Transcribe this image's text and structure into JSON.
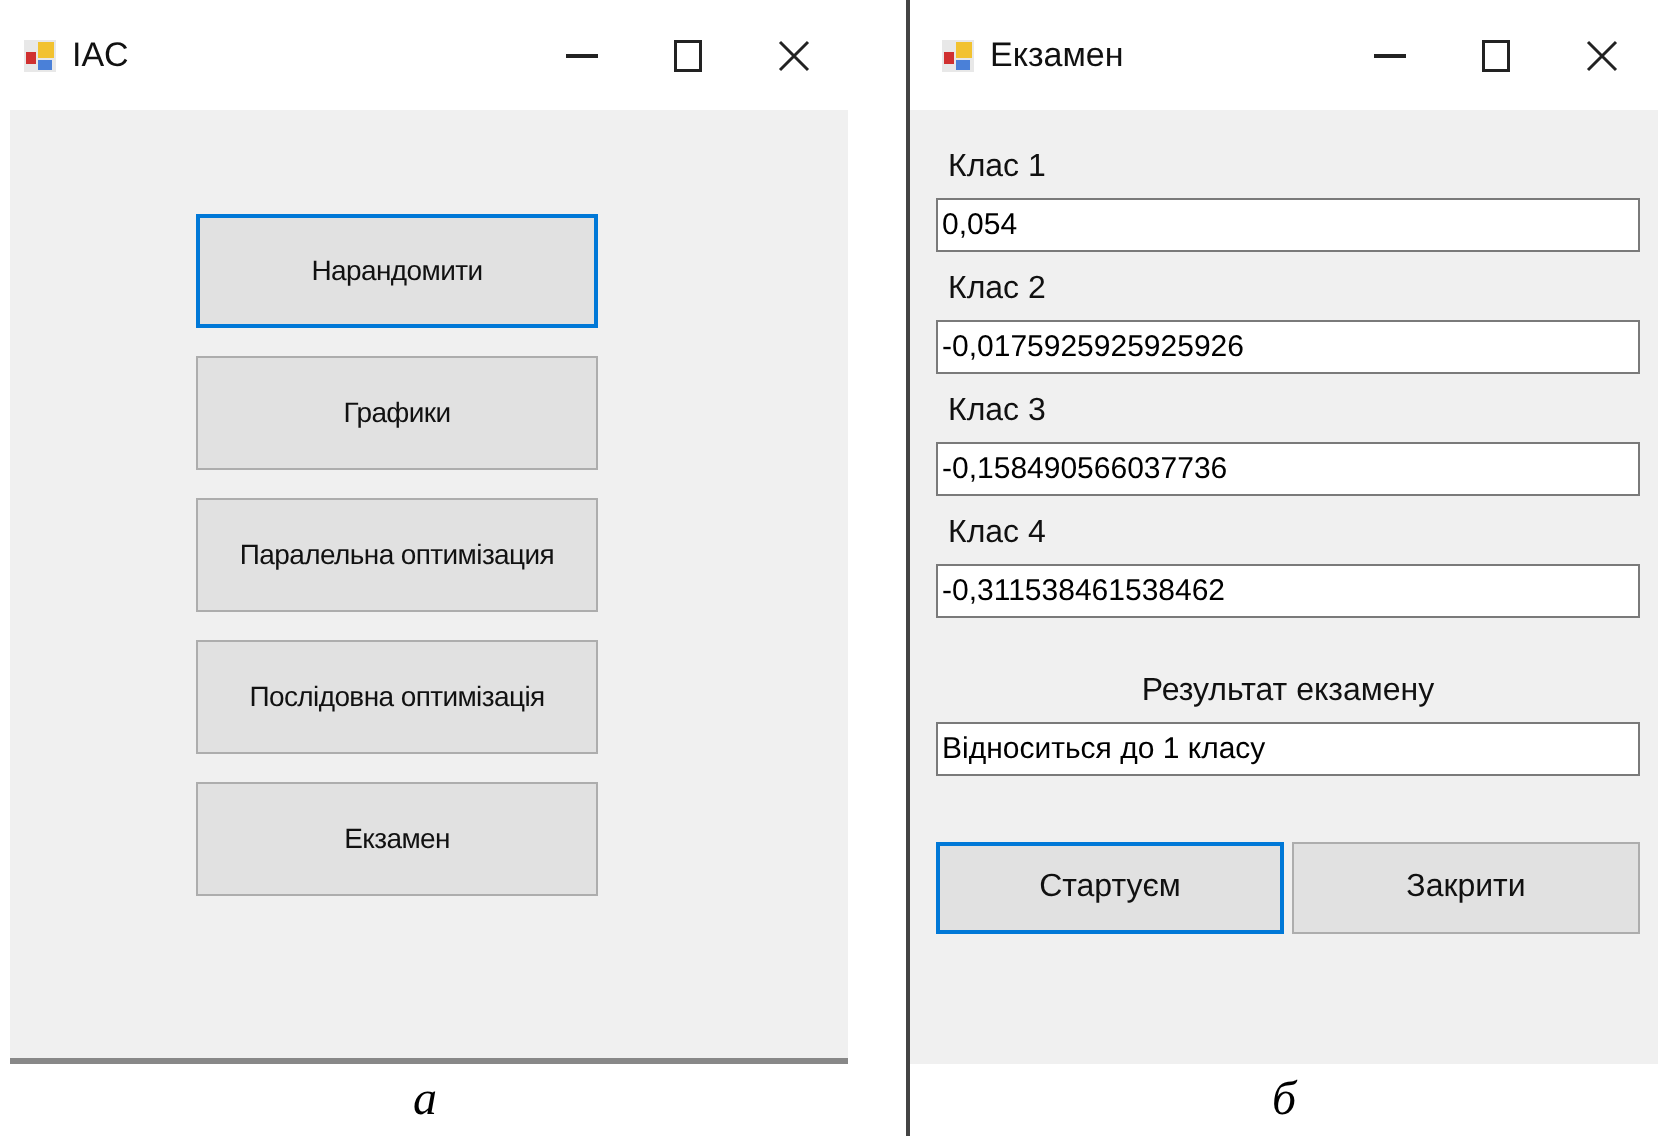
{
  "panels": [
    {
      "kind": "menu",
      "caption": "а",
      "window": {
        "title": "IAC"
      },
      "buttons": [
        {
          "label": "Нарандомити",
          "focused": true
        },
        {
          "label": "Графики",
          "focused": false
        },
        {
          "label": "Паралельна оптимізация",
          "focused": false
        },
        {
          "label": "Послідовна оптимізація",
          "focused": false
        },
        {
          "label": "Екзамен",
          "focused": false
        }
      ]
    },
    {
      "kind": "exam",
      "caption": "б",
      "window": {
        "title": "Екзамен"
      },
      "fields": [
        {
          "label": "Клас 1",
          "value": "0,054"
        },
        {
          "label": "Клас 2",
          "value": "-0,0175925925925926"
        },
        {
          "label": "Клас 3",
          "value": "-0,158490566037736"
        },
        {
          "label": "Клас 4",
          "value": "-0,311538461538462"
        }
      ],
      "result": {
        "label": "Результат екзамену",
        "value": "Відноситься до 1 класу"
      },
      "buttons": [
        {
          "label": "Стартуєм",
          "focused": true
        },
        {
          "label": "Закрити",
          "focused": false
        }
      ]
    }
  ]
}
